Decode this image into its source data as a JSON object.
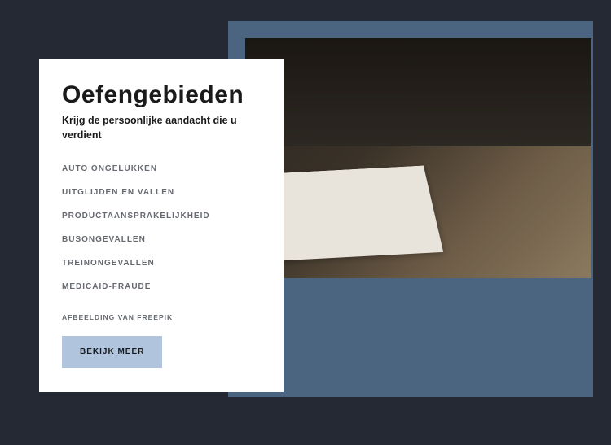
{
  "card": {
    "title": "Oefengebieden",
    "subtitle": "Krijg de persoonlijke aandacht die u verdient",
    "items": [
      "AUTO ONGELUKKEN",
      "UITGLIJDEN EN VALLEN",
      "PRODUCTAANSPRAKELIJKHEID",
      "BUSONGEVALLEN",
      "TREINONGEVALLEN",
      "MEDICAID-FRAUDE"
    ],
    "attribution_prefix": "AFBEELDING VAN ",
    "attribution_link": "FREEPIK",
    "button_label": "BEKIJK MEER"
  }
}
